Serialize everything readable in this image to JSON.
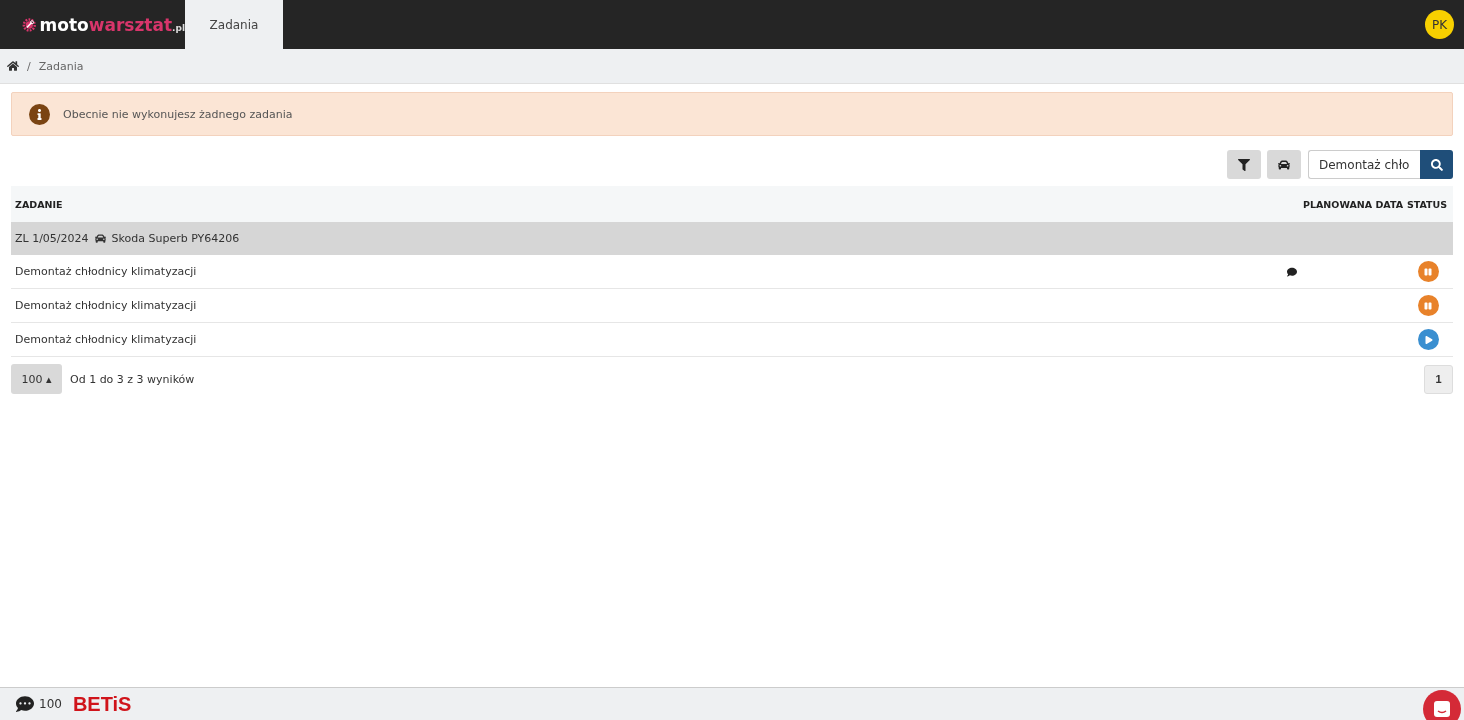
{
  "logo": {
    "main": "moto",
    "accent": "warsztat",
    "suffix": ".pl"
  },
  "nav": {
    "tabs": [
      {
        "label": "Zadania",
        "selected": true
      }
    ]
  },
  "user": {
    "initials": "PK"
  },
  "breadcrumb": {
    "separator": "/",
    "items": [
      "Zadania"
    ]
  },
  "alert": {
    "text": "Obecnie nie wykonujesz żadnego zadania"
  },
  "search": {
    "value": "Demontaż chło"
  },
  "table": {
    "columns": [
      "ZADANIE",
      "PLANOWANA DATA",
      "STATUS"
    ],
    "groups": [
      {
        "order": "ZL 1/05/2024",
        "vehicle": "Skoda Superb PY64206",
        "rows": [
          {
            "task": "Demontaż chłodnicy klimatyzacji",
            "has_comment": true,
            "paused": true
          },
          {
            "task": "Demontaż chłodnicy klimatyzacji",
            "has_comment": false,
            "paused": true
          },
          {
            "task": "Demontaż chłodnicy klimatyzacji",
            "has_comment": false,
            "paused": false
          }
        ]
      }
    ]
  },
  "pagination": {
    "page_size": "100",
    "caret": "▴",
    "summary": "Od 1 do 3 z 3 wyników",
    "pages": [
      {
        "label": "1",
        "selected": true
      }
    ]
  },
  "footer": {
    "sms_count": "100",
    "brand": "BETiS"
  }
}
